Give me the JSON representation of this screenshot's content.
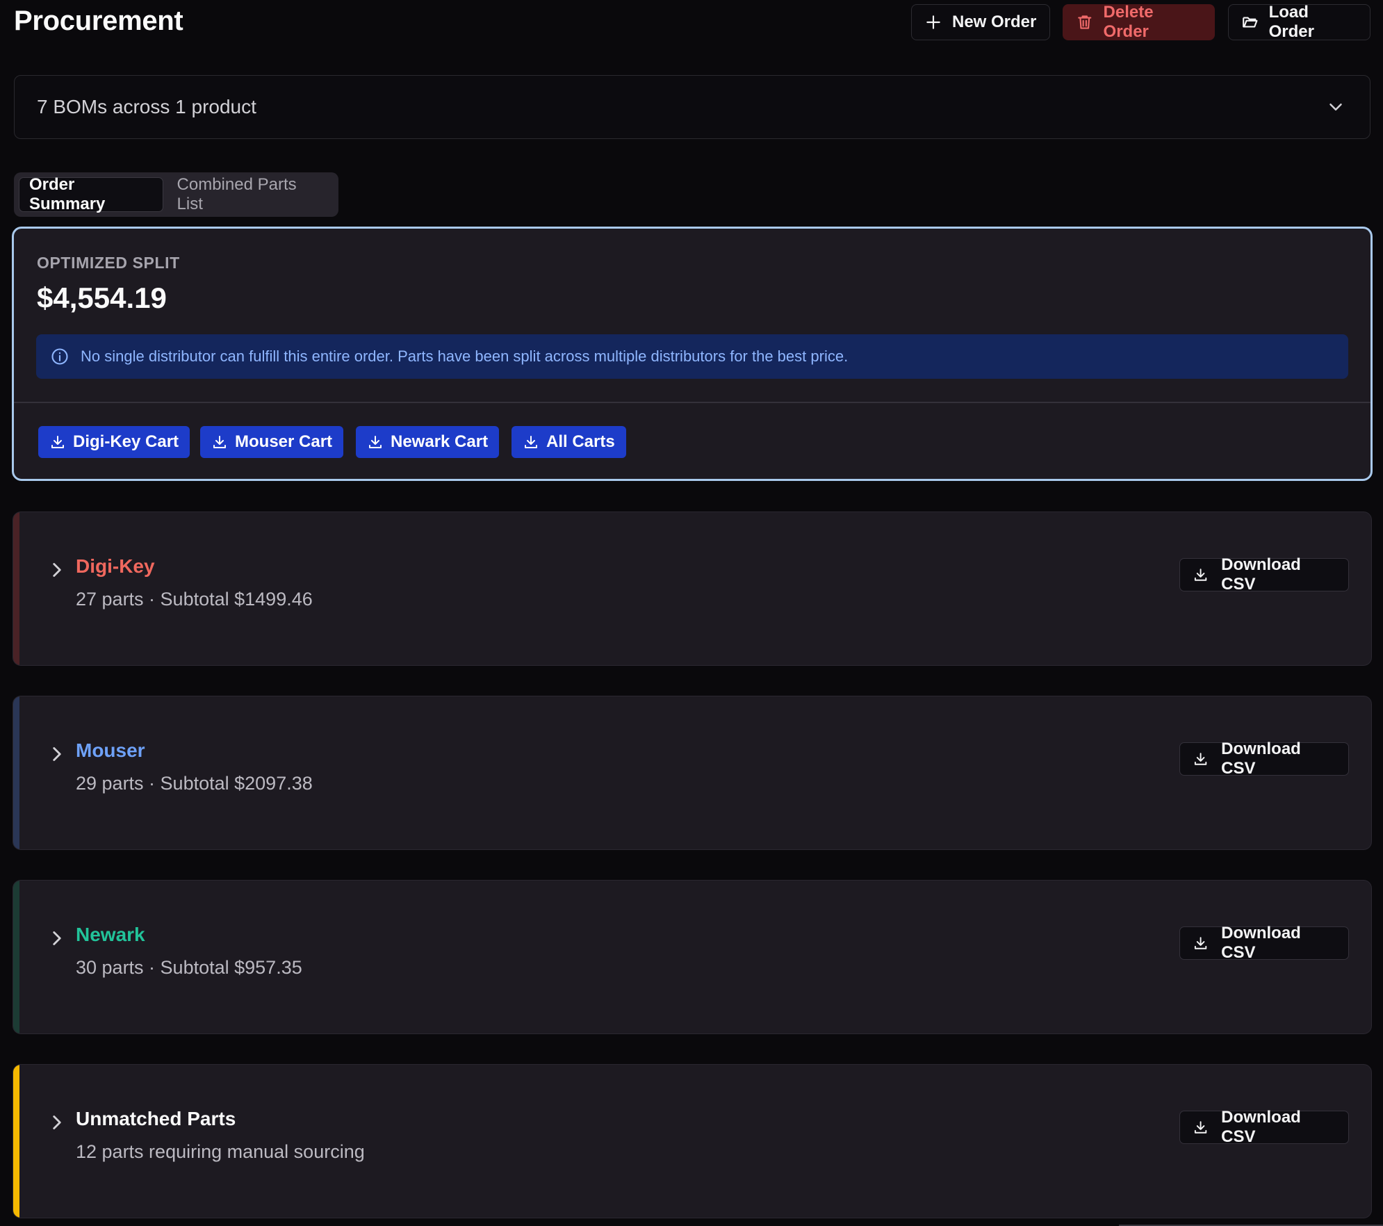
{
  "header": {
    "title": "Procurement",
    "new_order": "New Order",
    "delete_order": "Delete Order",
    "load_order": "Load Order"
  },
  "bom_selector": {
    "value": "7 BOMs across 1 product",
    "icon": "chevron-down-icon"
  },
  "tabs": [
    {
      "label": "Order Summary",
      "active": true
    },
    {
      "label": "Combined Parts List",
      "active": false
    }
  ],
  "summary": {
    "label": "OPTIMIZED SPLIT",
    "amount": "$4,554.19",
    "notice": "No single distributor can fulfill this entire order. Parts have been split across multiple distributors for the best price.",
    "cart_buttons": [
      "Digi-Key Cart",
      "Mouser Cart",
      "Newark Cart",
      "All Carts"
    ]
  },
  "distributors": [
    {
      "name": "Digi-Key",
      "summary": "27 parts · Subtotal $1499.46",
      "color": "#f0685e",
      "stripe": "#4a2226",
      "button": "Download CSV"
    },
    {
      "name": "Mouser",
      "summary": "29 parts · Subtotal $2097.38",
      "color": "#6ea1f7",
      "stripe": "#2a3656",
      "button": "Download CSV"
    },
    {
      "name": "Newark",
      "summary": "30 parts · Subtotal $957.35",
      "color": "#22c39a",
      "stripe": "#1c3b34",
      "button": "Download CSV"
    },
    {
      "name": "Unmatched Parts",
      "summary": "12 parts requiring manual sourcing",
      "color": "#fafafa",
      "stripe": "#f5b800",
      "button": "Download CSV"
    }
  ],
  "colors": {
    "accent_blue": "#1d3cc9",
    "danger": "#f06a6a",
    "summary_border": "#a9c9ec"
  }
}
